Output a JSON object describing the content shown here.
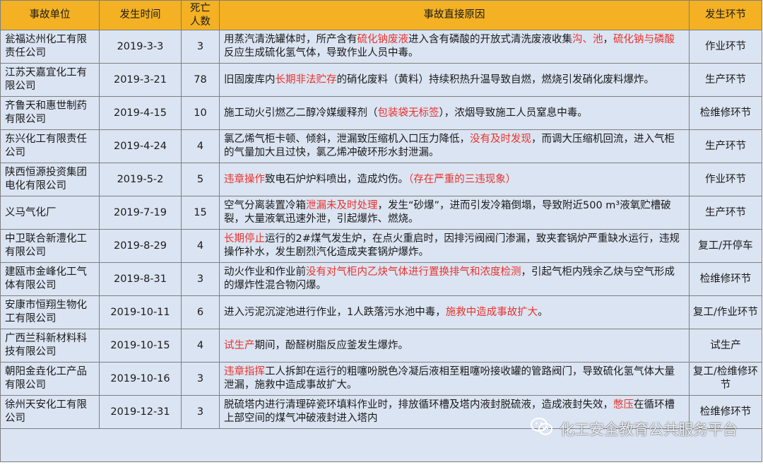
{
  "table": {
    "headers": [
      "事故单位",
      "发生时间",
      "死亡\n人数",
      "事故直接原因",
      "发生环节"
    ],
    "rows": [
      {
        "unit": "瓮福达州化工有限责任公司",
        "date": "2019-3-3",
        "deaths": "3",
        "cause": [
          {
            "t": "用蒸汽清洗罐体时，所产含有"
          },
          {
            "t": "硫化钠废液",
            "hl": true
          },
          {
            "t": "进入含有磷酸的开放式清洗废液收集"
          },
          {
            "t": "沟、池",
            "hl": true
          },
          {
            "t": "，"
          },
          {
            "t": "硫化钠与磷酸",
            "hl": true
          },
          {
            "t": "反应生成硫化氢气体，导致作业人员中毒。"
          }
        ],
        "stage": "作业环节"
      },
      {
        "unit": "江苏天嘉宜化工有限公司",
        "date": "2019-3-21",
        "deaths": "78",
        "cause": [
          {
            "t": "旧固废库内"
          },
          {
            "t": "长期非法贮存",
            "hl": true
          },
          {
            "t": "的硝化废料（黄料）持续积热升温导致自燃，燃烧引发硝化废料爆炸。"
          }
        ],
        "stage": "生产环节"
      },
      {
        "unit": "齐鲁天和惠世制药有限公司",
        "date": "2019-4-15",
        "deaths": "10",
        "cause": [
          {
            "t": "施工动火引燃乙二醇冷媒缓释剂（"
          },
          {
            "t": "包装袋无标签",
            "hl": true
          },
          {
            "t": "），浓烟导致施工人员窒息中毒。"
          }
        ],
        "stage": "检维修环节"
      },
      {
        "unit": "东兴化工有限责任公司",
        "date": "2019-4-24",
        "deaths": "4",
        "cause": [
          {
            "t": "氯乙烯气柜卡顿、倾斜，泄漏致压缩机入口压力降低，"
          },
          {
            "t": "没有及时发现",
            "hl": true
          },
          {
            "t": "，而调大压缩机回流，进入气柜的气量加大且过快，氯乙烯冲破环形水封泄漏。"
          }
        ],
        "stage": "生产环节"
      },
      {
        "unit": "陕西恒源投资集团电化有限公司",
        "date": "2019-5-2",
        "deaths": "5",
        "cause": [
          {
            "t": "违章操作",
            "hl": true
          },
          {
            "t": "致电石炉炉料喷出，造成灼伤。"
          },
          {
            "t": "（存在严重的三违现象）",
            "hl": true
          }
        ],
        "stage": "作业环节"
      },
      {
        "unit": "义马气化厂",
        "date": "2019-7-19",
        "deaths": "15",
        "cause": [
          {
            "t": "空气分离装置冷箱"
          },
          {
            "t": "泄漏未及时处理",
            "hl": true
          },
          {
            "t": "，发生“砂爆”，进而引发冷箱倒塌，导致附近500 m³液氧贮槽破裂，大量液氧迅速外泄，引起爆炸、燃烧。"
          }
        ],
        "stage": "生产环节"
      },
      {
        "unit": "中卫联合新澧化工有限公司",
        "date": "2019-8-29",
        "deaths": "4",
        "cause": [
          {
            "t": "长期停止",
            "hl": true
          },
          {
            "t": "运行的2#煤气发生炉，在点火重启时，因排污阀阀门渗漏，致夹套锅炉严重缺水运行，违规操作补水，发生剧烈汽化造成夹套锅炉爆炸。"
          }
        ],
        "stage": "复工/开停车"
      },
      {
        "unit": "建瓯市金峰化工气体有限公司",
        "date": "2019-8-31",
        "deaths": "3",
        "cause": [
          {
            "t": "动火作业和作业前"
          },
          {
            "t": "没有对气柜内乙炔气体进行置换排气和浓度检测",
            "hl": true
          },
          {
            "t": "，引起气柜内残余乙炔与空气形成的爆炸性混合物闪爆。"
          }
        ],
        "stage": "检维修环节"
      },
      {
        "unit": "安康市恒翔生物化工有限公司",
        "date": "2019-10-11",
        "deaths": "6",
        "cause": [
          {
            "t": "进入污泥沉淀池进行作业，1人跌落污水池中毒，"
          },
          {
            "t": "施救中造成事故扩大",
            "hl": true
          },
          {
            "t": "。"
          }
        ],
        "stage": "复工/作业环节"
      },
      {
        "unit": "广西兰科新材料科技有限公司",
        "date": "2019-10-15",
        "deaths": "4",
        "cause": [
          {
            "t": "试生产",
            "hl": true
          },
          {
            "t": "期间，酚醛树脂反应釜发生爆炸。"
          }
        ],
        "stage": "试生产"
      },
      {
        "unit": "朝阳金垚化工产品有限公司",
        "date": "2019-10-16",
        "deaths": "3",
        "cause": [
          {
            "t": "违章指挥",
            "hl": true
          },
          {
            "t": "工人拆卸在运行的粗噻吩脱色冷凝后液相至粗噻吩接收罐的管路阀门，导致硫化氢气体大量泄漏，施救中造成事故扩大。"
          }
        ],
        "stage": "复工/检维修环节"
      },
      {
        "unit": "徐州天安化工有限公司",
        "date": "2019-12-31",
        "deaths": "3",
        "cause": [
          {
            "t": "脱硫塔内进行清理碎瓷环填料作业时，排放循环槽及塔内液封脱硫液，造成液封失效，"
          },
          {
            "t": "憋压",
            "hl": true
          },
          {
            "t": "在循环槽上部空间的煤气冲破液封进入塔内"
          }
        ],
        "stage": "检维修环节"
      }
    ]
  },
  "watermark": {
    "icon": "wechat-icon",
    "text": "化工安全教育公共服务平台"
  },
  "colors": {
    "header_bg": "#f4b123",
    "row_bg": "#dbe4f2",
    "highlight": "#e8332d",
    "border": "#7f7f7f"
  }
}
